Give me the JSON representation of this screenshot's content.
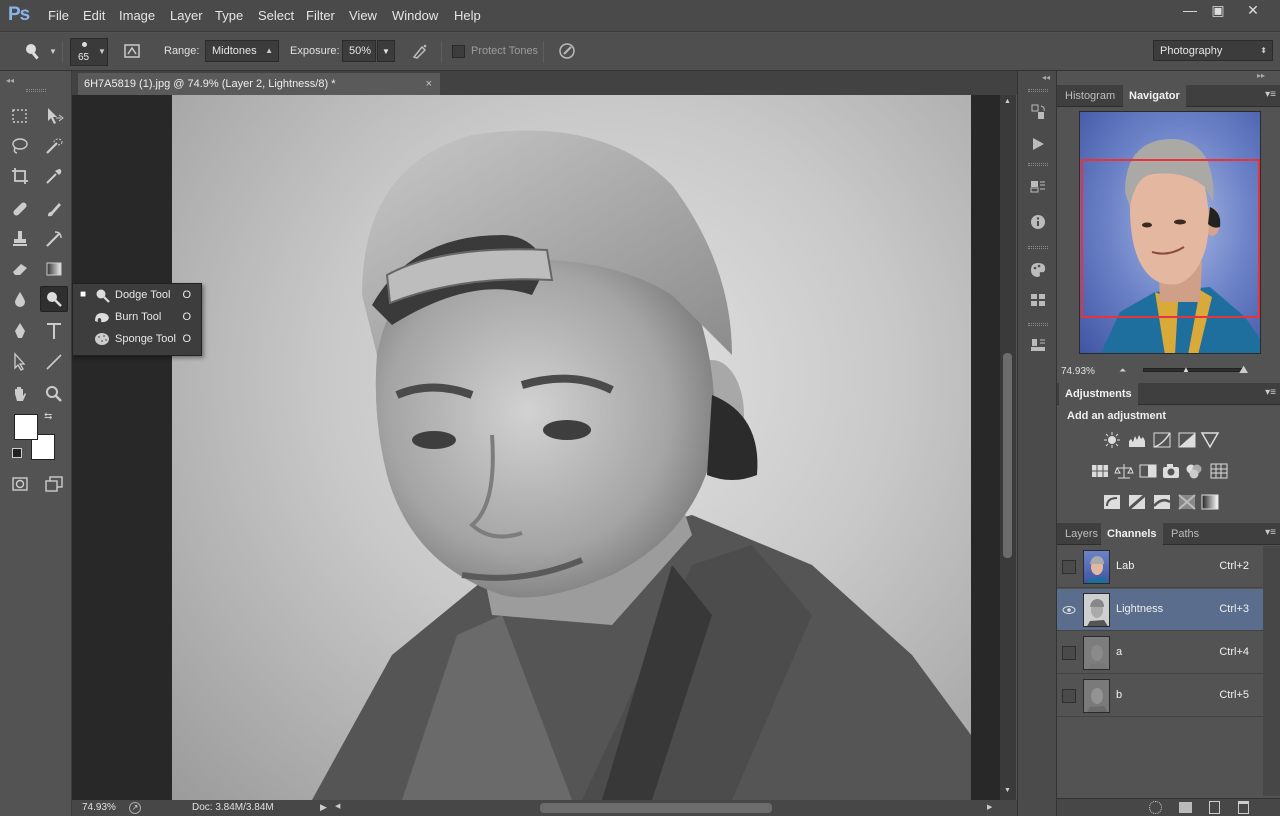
{
  "app": {
    "logo": "Ps"
  },
  "menu": [
    "File",
    "Edit",
    "Image",
    "Layer",
    "Type",
    "Select",
    "Filter",
    "View",
    "Window",
    "Help"
  ],
  "window_buttons": {
    "minimize": "—",
    "maximize": "▣",
    "close": "✕"
  },
  "options": {
    "brush_size": "65",
    "range_label": "Range:",
    "range_value": "Midtones",
    "exposure_label": "Exposure:",
    "exposure_value": "50%",
    "protect_tones": "Protect Tones",
    "workspace": "Photography"
  },
  "document": {
    "tab_title": "6H7A5819 (1).jpg @ 74.9% (Layer 2, Lightness/8) *",
    "tab_close": "×",
    "zoom": "74.93%",
    "doc_size": "Doc: 3.84M/3.84M"
  },
  "flyout": [
    {
      "label": "Dodge Tool",
      "key": "O",
      "selected": true
    },
    {
      "label": "Burn Tool",
      "key": "O",
      "selected": false
    },
    {
      "label": "Sponge Tool",
      "key": "O",
      "selected": false
    }
  ],
  "panels": {
    "top_tabs": [
      "Histogram",
      "Navigator"
    ],
    "navigator_zoom": "74.93%",
    "adjustments_tab": "Adjustments",
    "adjustments_heading": "Add an adjustment",
    "layer_tabs": [
      "Layers",
      "Channels",
      "Paths"
    ]
  },
  "channels": [
    {
      "name": "Lab",
      "shortcut": "Ctrl+2",
      "visible": false,
      "selected": false
    },
    {
      "name": "Lightness",
      "shortcut": "Ctrl+3",
      "visible": true,
      "selected": true
    },
    {
      "name": "a",
      "shortcut": "Ctrl+4",
      "visible": false,
      "selected": false
    },
    {
      "name": "b",
      "shortcut": "Ctrl+5",
      "visible": false,
      "selected": false
    }
  ],
  "colors": {
    "accent_selected_row": "#5a6d8d",
    "navigator_frame": "#e8333a",
    "logo": "#8ab4e8"
  }
}
